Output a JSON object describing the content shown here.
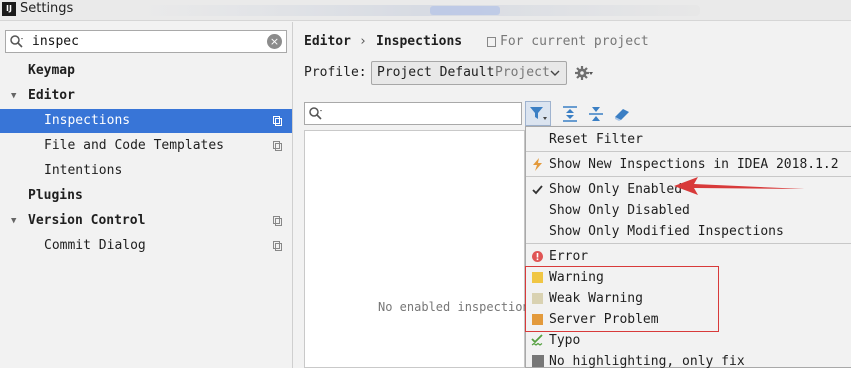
{
  "window": {
    "title": "Settings",
    "app_icon": "IJ"
  },
  "sidebar": {
    "search_value": "inspec",
    "items": [
      {
        "label": "Keymap",
        "bold": true
      },
      {
        "label": "Editor",
        "bold": true
      },
      {
        "label": "Inspections",
        "selected": true
      },
      {
        "label": "File and Code Templates"
      },
      {
        "label": "Intentions"
      },
      {
        "label": "Plugins",
        "bold": true
      },
      {
        "label": "Version Control",
        "bold": true
      },
      {
        "label": "Commit Dialog"
      }
    ]
  },
  "content": {
    "breadcrumb_1": "Editor",
    "breadcrumb_sep": "›",
    "breadcrumb_2": "Inspections",
    "for_current_project": "For current project",
    "profile_label": "Profile:",
    "profile_value": "Project Default",
    "profile_scope": "Project",
    "empty_message": "No enabled inspection"
  },
  "filter_menu": {
    "reset": "Reset Filter",
    "show_new": "Show New Inspections in IDEA 2018.1.2",
    "show_only_enabled": "Show Only Enabled",
    "show_only_disabled": "Show Only Disabled",
    "show_only_modified": "Show Only Modified Inspections",
    "severities": [
      {
        "label": "Error",
        "color": "#e05555"
      },
      {
        "label": "Warning",
        "color": "#f0c644"
      },
      {
        "label": "Weak Warning",
        "color": "#d9d2b2"
      },
      {
        "label": "Server Problem",
        "color": "#e39a3c"
      },
      {
        "label": "Typo",
        "color": "#55a040"
      },
      {
        "label": "No highlighting, only fix",
        "color": "#777777"
      }
    ]
  },
  "colors": {
    "selection": "#3875d7",
    "annotation_red": "#d83a3a"
  }
}
